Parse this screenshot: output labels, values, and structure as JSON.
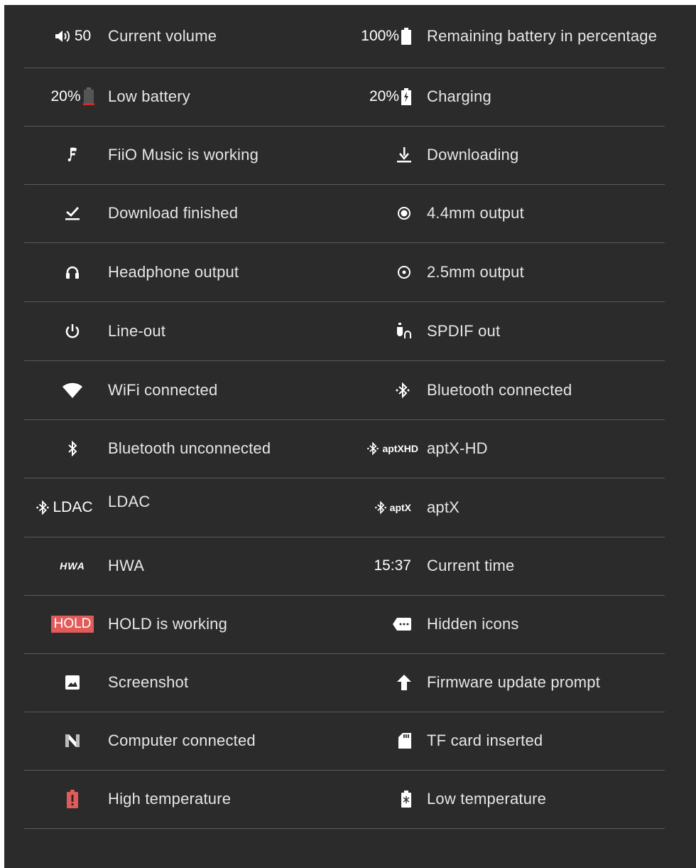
{
  "rows": [
    {
      "left": {
        "icon_text": "50",
        "label": "Current volume"
      },
      "right": {
        "icon_text": "100%",
        "label": "Remaining battery in percentage"
      }
    },
    {
      "left": {
        "icon_text": "20%",
        "label": "Low battery"
      },
      "right": {
        "icon_text": "20%",
        "label": "Charging"
      }
    },
    {
      "left": {
        "label": "FiiO Music is working"
      },
      "right": {
        "label": "Downloading"
      }
    },
    {
      "left": {
        "label": "Download finished"
      },
      "right": {
        "label": "4.4mm output"
      }
    },
    {
      "left": {
        "label": "Headphone output"
      },
      "right": {
        "label": "2.5mm output"
      }
    },
    {
      "left": {
        "label": "Line-out"
      },
      "right": {
        "label": "SPDIF out"
      }
    },
    {
      "left": {
        "label": "WiFi connected"
      },
      "right": {
        "label": "Bluetooth connected"
      }
    },
    {
      "left": {
        "label": "Bluetooth unconnected"
      },
      "right": {
        "icon_text": "aptXHD",
        "label": "aptX-HD"
      }
    },
    {
      "left": {
        "icon_text": "LDAC",
        "label": "LDAC"
      },
      "right": {
        "icon_text": "aptX",
        "label": "aptX"
      }
    },
    {
      "left": {
        "icon_text": "HWA",
        "label": "HWA"
      },
      "right": {
        "icon_text": "15:37",
        "label": "Current time"
      }
    },
    {
      "left": {
        "icon_text": "HOLD",
        "label": "HOLD is working"
      },
      "right": {
        "label": "Hidden icons"
      }
    },
    {
      "left": {
        "label": "Screenshot"
      },
      "right": {
        "label": "Firmware update prompt"
      }
    },
    {
      "left": {
        "label": "Computer connected"
      },
      "right": {
        "label": "TF card inserted"
      }
    },
    {
      "left": {
        "label": "High temperature"
      },
      "right": {
        "label": "Low temperature"
      }
    }
  ],
  "icons": [
    [
      "volume-icon",
      "battery-full-icon"
    ],
    [
      "battery-low-icon",
      "battery-charging-icon"
    ],
    [
      "fiio-music-icon",
      "download-icon"
    ],
    [
      "download-finished-icon",
      "output-4-4mm-icon"
    ],
    [
      "headphone-icon",
      "output-2-5mm-icon"
    ],
    [
      "line-out-icon",
      "spdif-icon"
    ],
    [
      "wifi-icon",
      "bluetooth-connected-icon"
    ],
    [
      "bluetooth-icon",
      "aptx-hd-icon"
    ],
    [
      "ldac-icon",
      "aptx-icon"
    ],
    [
      "hwa-icon",
      "clock-text"
    ],
    [
      "hold-badge",
      "hidden-icons-icon"
    ],
    [
      "screenshot-icon",
      "firmware-update-icon"
    ],
    [
      "computer-connected-icon",
      "tf-card-icon"
    ],
    [
      "high-temperature-icon",
      "low-temperature-icon"
    ]
  ],
  "colors": {
    "background": "#2b2b2b",
    "divider": "#5a5a5a",
    "text": "#e6e6e6",
    "alert_red": "#e25b5b",
    "low_battery_red": "#d42a2a"
  }
}
